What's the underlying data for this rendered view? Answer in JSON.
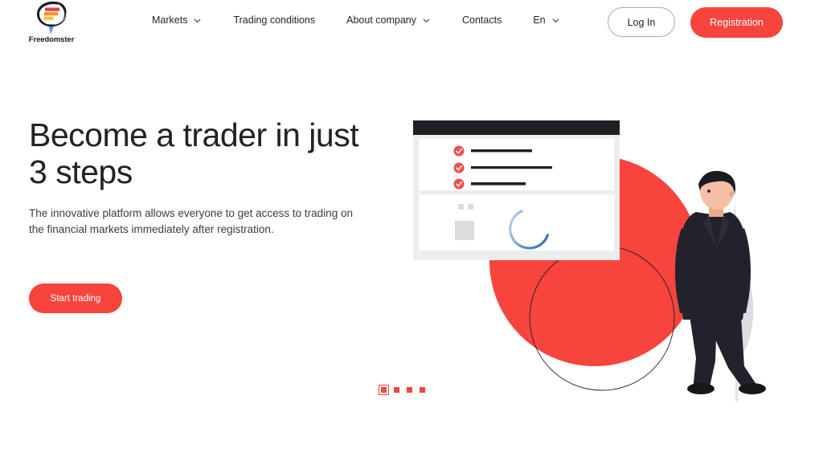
{
  "brand": {
    "name": "Freedomster",
    "logo_icon": "freedomster-logo-icon",
    "accent_color": "#f7443d",
    "logo_colors": [
      "#e8453c",
      "#f0932b",
      "#f2c14e",
      "#1a1a1f",
      "#6f8fd6"
    ]
  },
  "header": {
    "nav": [
      {
        "label": "Markets",
        "has_dropdown": true,
        "icon": "chevron-down-icon"
      },
      {
        "label": "Trading conditions",
        "has_dropdown": false,
        "icon": ""
      },
      {
        "label": "About company",
        "has_dropdown": true,
        "icon": "chevron-down-icon"
      },
      {
        "label": "Contacts",
        "has_dropdown": false,
        "icon": ""
      },
      {
        "label": "En",
        "has_dropdown": true,
        "icon": "chevron-down-icon"
      }
    ],
    "login_label": "Log In",
    "registration_label": "Registration"
  },
  "hero": {
    "title": "Become a trader in just 3 steps",
    "subtitle": "The innovative platform allows everyone to get access to trading on the financial markets immediately after registration.",
    "cta_label": "Start trading"
  },
  "carousel": {
    "total_slides": 4,
    "active_slide": 1
  },
  "illustration": {
    "name": "trader-onboarding-illustration",
    "window_card": {
      "titlebar_color": "#1f1f26",
      "checklist_items": 3,
      "checkmark_icon": "check-circle-icon",
      "spinner_icon": "loading-spinner-icon"
    },
    "shapes": {
      "filled_circle_color": "#f7443d",
      "outline_circle_color": "#1f1f26",
      "tree_color": "#dcdde1",
      "person_suit_color": "#22222c",
      "person_shirt_color": "#b9bac0",
      "person_skin_color": "#f6bfa6"
    }
  }
}
